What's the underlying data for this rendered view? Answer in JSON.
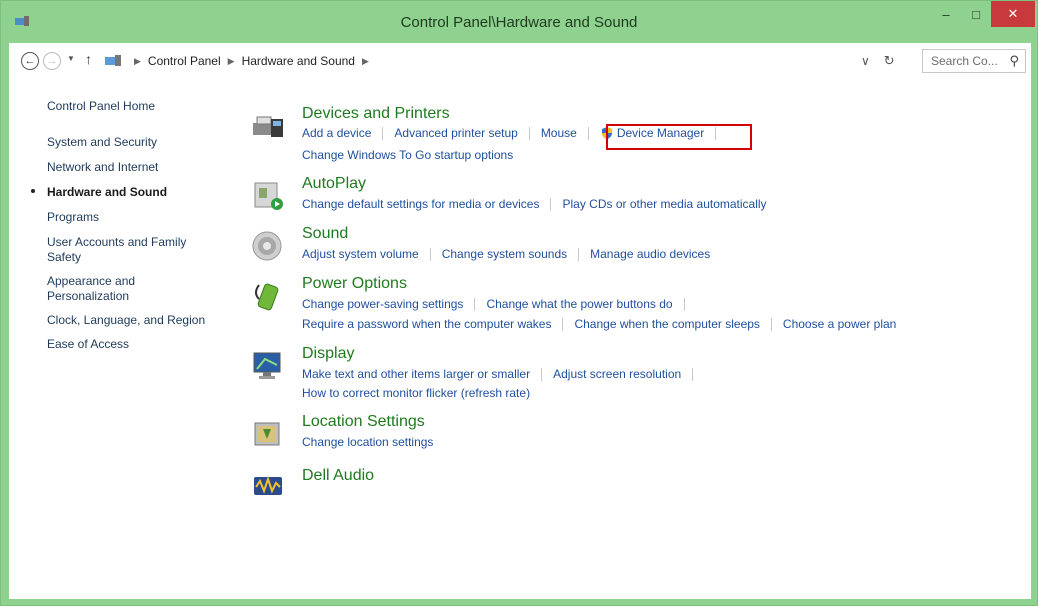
{
  "window": {
    "title": "Control Panel\\Hardware and Sound",
    "min_glyph": "–",
    "max_glyph": "□",
    "close_glyph": "✕"
  },
  "nav": {
    "back_glyph": "←",
    "fwd_glyph": "→",
    "dropdown_glyph": "▼",
    "up_glyph": "↑",
    "breadcrumbs": [
      "Control Panel",
      "Hardware and Sound"
    ],
    "sep_glyph": "▶",
    "history_glyph": "∨",
    "refresh_glyph": "↻",
    "search_placeholder": "Search Co...",
    "search_glyph": "⚲"
  },
  "sidebar": {
    "items": [
      {
        "label": "Control Panel Home"
      },
      {
        "label": "System and Security"
      },
      {
        "label": "Network and Internet"
      },
      {
        "label": "Hardware and Sound",
        "current": true
      },
      {
        "label": "Programs"
      },
      {
        "label": "User Accounts and Family\nSafety"
      },
      {
        "label": "Appearance and\nPersonalization"
      },
      {
        "label": "Clock, Language, and Region"
      },
      {
        "label": "Ease of Access"
      }
    ]
  },
  "categories": {
    "devices": {
      "title": "Devices and Printers",
      "icon": "printer-icon",
      "links": [
        "Add a device",
        "Advanced printer setup",
        "Mouse",
        "Device Manager"
      ],
      "links2": [
        "Change Windows To Go startup options"
      ]
    },
    "autoplay": {
      "title": "AutoPlay",
      "icon": "autoplay-icon",
      "links": [
        "Change default settings for media or devices",
        "Play CDs or other media automatically"
      ]
    },
    "sound": {
      "title": "Sound",
      "icon": "speaker-icon",
      "links": [
        "Adjust system volume",
        "Change system sounds",
        "Manage audio devices"
      ]
    },
    "power": {
      "title": "Power Options",
      "icon": "battery-icon",
      "links": [
        "Change power-saving settings",
        "Change what the power buttons do"
      ],
      "links2": [
        "Require a password when the computer wakes",
        "Change when the computer sleeps",
        "Choose a power plan"
      ]
    },
    "display": {
      "title": "Display",
      "icon": "monitor-icon",
      "links": [
        "Make text and other items larger or smaller",
        "Adjust screen resolution"
      ],
      "links2": [
        "How to correct monitor flicker (refresh rate)"
      ]
    },
    "location": {
      "title": "Location Settings",
      "icon": "location-icon",
      "links": [
        "Change location settings"
      ]
    },
    "dell": {
      "title": "Dell Audio",
      "icon": "dell-audio-icon"
    }
  },
  "colors": {
    "title_bar": "#8fd18f",
    "link": "#1f4f9e",
    "category_title": "#1f7a1f",
    "highlight_box": "#d40000"
  }
}
